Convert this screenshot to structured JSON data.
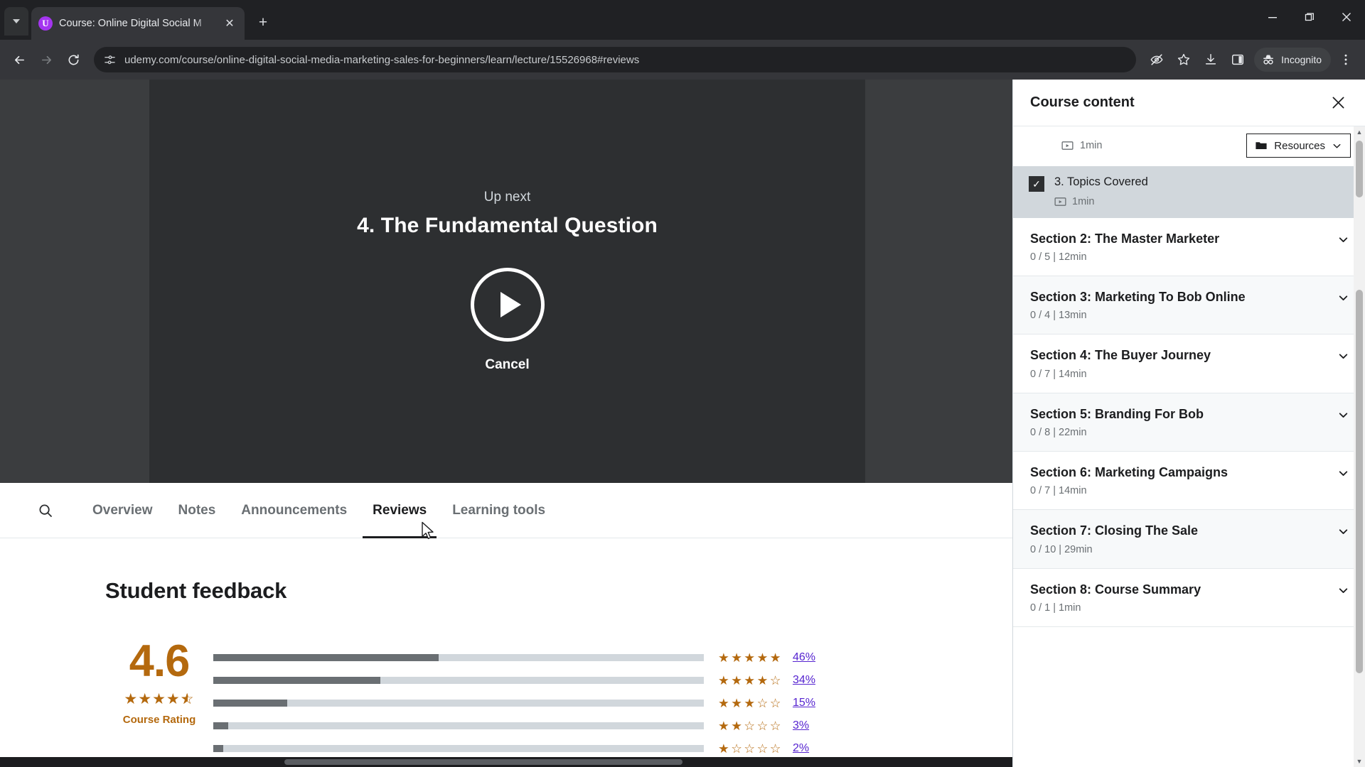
{
  "browser": {
    "tab": {
      "title": "Course: Online Digital Social M",
      "favicon_letter": "U"
    },
    "new_tab_label": "+",
    "close_tab_label": "✕",
    "url": "udemy.com/course/online-digital-social-media-marketing-sales-for-beginners/learn/lecture/15526968#reviews",
    "profile_label": "Incognito",
    "icons": {
      "back": "back-arrow-icon",
      "forward": "forward-arrow-icon",
      "reload": "reload-icon",
      "site_info": "site-settings-icon",
      "tracking": "eye-off-icon",
      "bookmark": "star-icon",
      "downloads": "download-icon",
      "side_panel": "side-panel-icon",
      "incognito": "incognito-hat-icon",
      "menu": "kebab-menu-icon",
      "minimize": "minimize-icon",
      "maximize": "maximize-icon",
      "close": "window-close-icon"
    }
  },
  "player": {
    "up_next_label": "Up next",
    "next_lecture_title": "4. The Fundamental Question",
    "cancel_label": "Cancel",
    "play_icon": "play-icon"
  },
  "course_tabs": {
    "search_icon": "search-icon",
    "items": [
      {
        "label": "Overview",
        "active": false
      },
      {
        "label": "Notes",
        "active": false
      },
      {
        "label": "Announcements",
        "active": false
      },
      {
        "label": "Reviews",
        "active": true
      },
      {
        "label": "Learning tools",
        "active": false
      }
    ]
  },
  "reviews": {
    "heading": "Student feedback",
    "score": "4.6",
    "score_caption": "Course Rating",
    "score_stars": 4.5
  },
  "chart_data": {
    "type": "bar",
    "title": "Student feedback rating distribution",
    "categories": [
      "5 stars",
      "4 stars",
      "3 stars",
      "2 stars",
      "1 star"
    ],
    "values": [
      46,
      34,
      15,
      3,
      2
    ],
    "value_labels": [
      "46%",
      "34%",
      "15%",
      "3%",
      "2%"
    ],
    "star_counts": [
      5,
      4,
      3,
      2,
      1
    ],
    "xlabel": "",
    "ylabel": "",
    "xlim": [
      0,
      100
    ],
    "grid": false,
    "legend": "none",
    "orientation": "horizontal",
    "bar_color": "#6a6f73",
    "track_color": "#d1d7dc",
    "label_color": "#5624d0",
    "star_color": "#b4690e"
  },
  "sidebar": {
    "title": "Course content",
    "close_icon": "close-icon",
    "current_lecture": {
      "top_duration": "1min",
      "top_duration_icon": "video-icon",
      "resources_label": "Resources",
      "resources_icon": "folder-icon",
      "resources_chevron": "chevron-down-icon",
      "name": "3. Topics Covered",
      "duration": "1min",
      "duration_icon": "video-icon",
      "completed": true,
      "check_glyph": "✓"
    },
    "sections": [
      {
        "title": "Section 2: The Master Marketer",
        "meta": "0 / 5 | 12min"
      },
      {
        "title": "Section 3: Marketing To Bob Online",
        "meta": "0 / 4 | 13min"
      },
      {
        "title": "Section 4: The Buyer Journey",
        "meta": "0 / 7 | 14min"
      },
      {
        "title": "Section 5: Branding For Bob",
        "meta": "0 / 8 | 22min"
      },
      {
        "title": "Section 6: Marketing Campaigns",
        "meta": "0 / 7 | 14min"
      },
      {
        "title": "Section 7: Closing The Sale",
        "meta": "0 / 10 | 29min"
      },
      {
        "title": "Section 8: Course Summary",
        "meta": "0 / 1 | 1min"
      }
    ]
  }
}
